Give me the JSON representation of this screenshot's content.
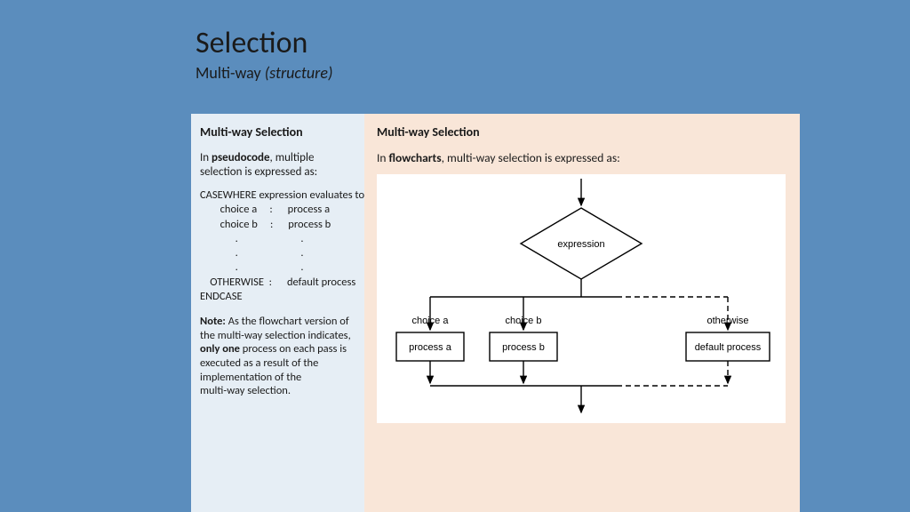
{
  "header": {
    "title": "Selection",
    "subtitle_main": "Multi-way ",
    "subtitle_paren": "(structure)"
  },
  "left": {
    "heading": "Multi-way Selection",
    "intro_pre": "In ",
    "intro_bold": "pseudocode",
    "intro_post": ", multiple selection is expressed as:",
    "pseudo": "CASEWHERE expression evaluates to\n        choice a     :      process a\n        choice b     :      process b\n              .                         .\n              .                         .\n              .                         .\n    OTHERWISE  :      default process\nENDCASE",
    "note_label": "Note:",
    "note_pre": " As the flowchart version of the multi-way selection indicates, ",
    "note_bold": "only one",
    "note_post": " process on each pass is executed as a result of the implementation of the",
    "note_tail": "multi-way selection."
  },
  "right": {
    "heading": "Multi-way Selection",
    "intro_pre": "In ",
    "intro_bold": "flowcharts",
    "intro_post": ", multi-way selection is expressed as:"
  },
  "flowchart": {
    "expression": "expression",
    "choice_a": "choice a",
    "choice_b": "choice b",
    "otherwise": "otherwise",
    "process_a": "process a",
    "process_b": "process b",
    "default_process": "default process"
  }
}
